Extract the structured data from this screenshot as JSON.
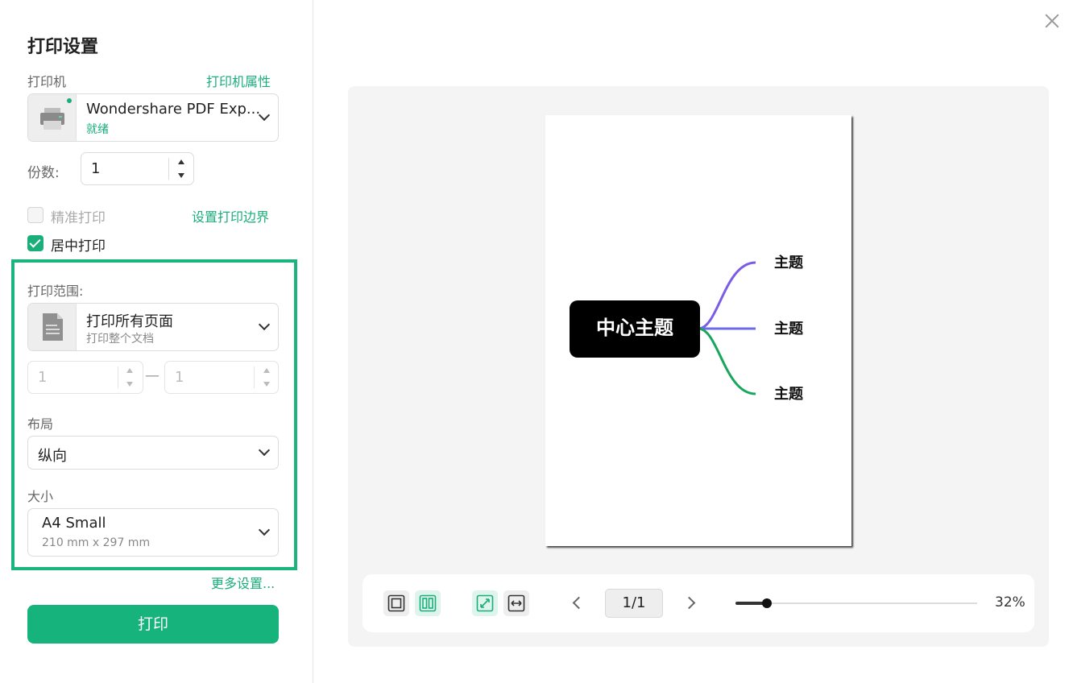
{
  "dialog": {
    "title": "打印设置"
  },
  "printer": {
    "label": "打印机",
    "properties_link": "打印机属性",
    "name": "Wondershare PDF Exp...",
    "status": "就绪",
    "icon": "printer-icon"
  },
  "copies": {
    "label": "份数:",
    "value": "1"
  },
  "options": {
    "precise_print": {
      "label": "精准打印",
      "checked": false,
      "enabled": false
    },
    "set_margins_link": "设置打印边界",
    "center_print": {
      "label": "居中打印",
      "checked": true
    }
  },
  "range": {
    "label": "打印范围:",
    "selected_main": "打印所有页面",
    "selected_sub": "打印整个文档",
    "icon": "document-icon",
    "from": "1",
    "to": "1",
    "separator": "—"
  },
  "layout": {
    "label": "布局",
    "value": "纵向"
  },
  "size": {
    "label": "大小",
    "value": "A4 Small",
    "dimensions": "210 mm x 297 mm"
  },
  "more_settings": "更多设置...",
  "print_button": "打印",
  "preview": {
    "mindmap": {
      "center": "中心主题",
      "topics": [
        "主题",
        "主题",
        "主题"
      ],
      "colors": [
        "#7b5ce6",
        "#6b6be8",
        "#18a55c"
      ]
    },
    "toolbar": {
      "page_indicator": "1/1",
      "zoom": "32%",
      "zoom_fraction": 0.13
    }
  },
  "colors": {
    "accent": "#1aae7a",
    "highlight_frame": "#1ab47c"
  }
}
